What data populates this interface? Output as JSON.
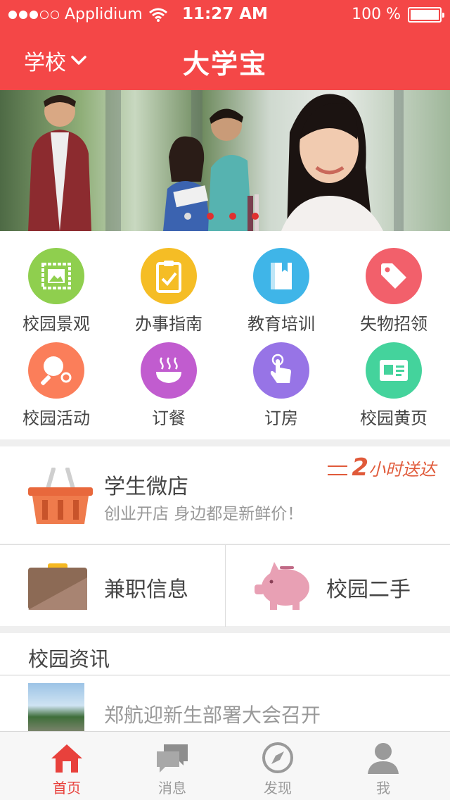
{
  "status_bar": {
    "carrier": "Applidium",
    "time": "11:27 AM",
    "battery": "100 %"
  },
  "nav": {
    "school_label": "学校",
    "title": "大学宝"
  },
  "banner": {
    "page_count": 4,
    "active_page": 1
  },
  "grid": {
    "items": [
      {
        "label": "校园景观",
        "icon": "picture-icon",
        "color": "#8fcf4e"
      },
      {
        "label": "办事指南",
        "icon": "clipboard-icon",
        "color": "#f5bd25"
      },
      {
        "label": "教育培训",
        "icon": "book-icon",
        "color": "#3fb5e8"
      },
      {
        "label": "失物招领",
        "icon": "tag-icon",
        "color": "#f2606b"
      },
      {
        "label": "校园活动",
        "icon": "ping-pong-icon",
        "color": "#fb7e5a"
      },
      {
        "label": "订餐",
        "icon": "bowl-icon",
        "color": "#c15ccf"
      },
      {
        "label": "订房",
        "icon": "hand-tap-icon",
        "color": "#9774e6"
      },
      {
        "label": "校园黄页",
        "icon": "card-icon",
        "color": "#44d39c"
      }
    ]
  },
  "shop": {
    "title": "学生微店",
    "subtitle": "创业开店  身边都是新鲜价！",
    "promo_number": "2",
    "promo_text": "小时送达"
  },
  "services": {
    "left_label": "兼职信息",
    "right_label": "校园二手"
  },
  "news": {
    "section_title": "校园资讯",
    "items": [
      {
        "headline": "郑航迎新生部署大会召开"
      }
    ]
  },
  "tabbar": {
    "items": [
      {
        "label": "首页",
        "icon": "home-icon",
        "active": true
      },
      {
        "label": "消息",
        "icon": "chat-icon",
        "active": false
      },
      {
        "label": "发现",
        "icon": "compass-icon",
        "active": false
      },
      {
        "label": "我",
        "icon": "user-icon",
        "active": false
      }
    ]
  },
  "colors": {
    "brand_red": "#f44747",
    "tab_active": "#e8413c"
  }
}
